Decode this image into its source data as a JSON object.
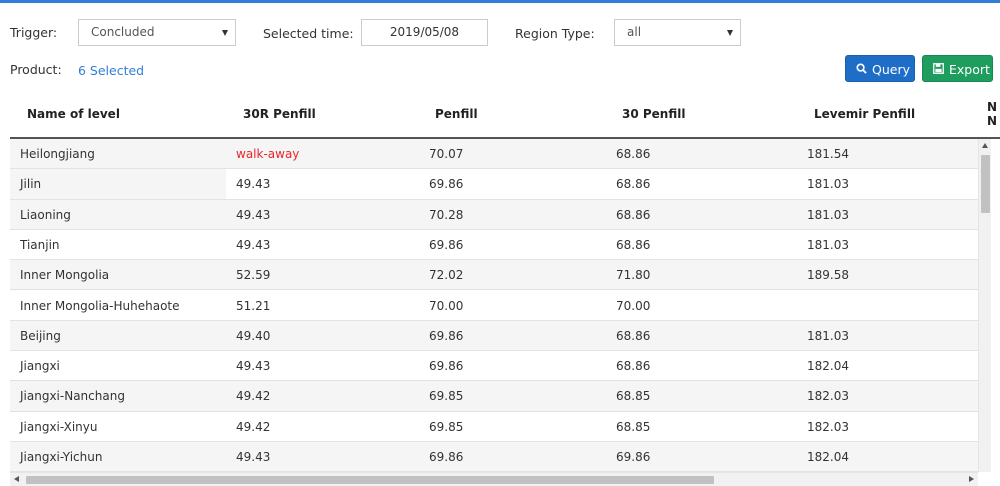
{
  "filters": {
    "trigger_label": "Trigger:",
    "trigger_value": "Concluded",
    "selected_time_label": "Selected time:",
    "selected_time_value": "2019/05/08",
    "region_type_label": "Region Type:",
    "region_type_value": "all",
    "product_label": "Product:",
    "product_selected": "6 Selected"
  },
  "buttons": {
    "query_label": "Query",
    "export_label": "Export"
  },
  "colors": {
    "accent": "#2f7ed8",
    "query_button": "#1e6ec8",
    "export_button": "#1f9d5e",
    "walk_away_text": "#e8262a"
  },
  "icons": {
    "query": "search-icon",
    "export": "save-icon",
    "dropdown": "caret-down-icon"
  },
  "table": {
    "headers": [
      "Name of level",
      "30R Penfill",
      "Penfill",
      "30 Penfill",
      "Levemir Penfill",
      "N",
      "N"
    ],
    "rows": [
      [
        "Heilongjiang",
        "walk-away",
        "70.07",
        "68.86",
        "181.54"
      ],
      [
        "Jilin",
        "49.43",
        "69.86",
        "68.86",
        "181.03"
      ],
      [
        "Liaoning",
        "49.43",
        "70.28",
        "68.86",
        "181.03"
      ],
      [
        "Tianjin",
        "49.43",
        "69.86",
        "68.86",
        "181.03"
      ],
      [
        "Inner Mongolia",
        "52.59",
        "72.02",
        "71.80",
        "189.58"
      ],
      [
        "Inner Mongolia-Huhehaote",
        "51.21",
        "70.00",
        "70.00",
        ""
      ],
      [
        "Beijing",
        "49.40",
        "69.86",
        "68.86",
        "181.03"
      ],
      [
        "Jiangxi",
        "49.43",
        "69.86",
        "68.86",
        "182.04"
      ],
      [
        "Jiangxi-Nanchang",
        "49.42",
        "69.85",
        "68.85",
        "182.03"
      ],
      [
        "Jiangxi-Xinyu",
        "49.42",
        "69.85",
        "68.85",
        "182.03"
      ],
      [
        "Jiangxi-Yichun",
        "49.43",
        "69.86",
        "69.86",
        "182.04"
      ]
    ]
  }
}
